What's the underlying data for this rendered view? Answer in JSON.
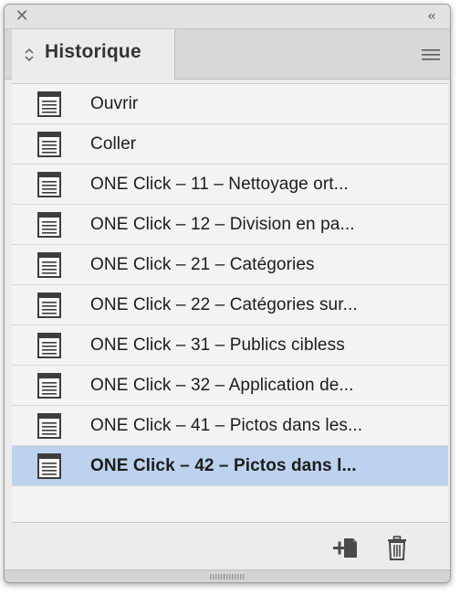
{
  "titlebar": {
    "close_icon": "close-icon",
    "collapse_icon": "double-chevron-left-icon"
  },
  "tab": {
    "label": "Historique",
    "icon": "up-down-chevron-icon"
  },
  "panel_menu_icon": "hamburger-menu-icon",
  "history": {
    "items": [
      {
        "label": "Ouvrir",
        "selected": false
      },
      {
        "label": "Coller",
        "selected": false
      },
      {
        "label": "ONE Click – 11 – Nettoyage ort...",
        "selected": false
      },
      {
        "label": "ONE Click – 12 – Division en pa...",
        "selected": false
      },
      {
        "label": "ONE Click – 21 – Catégories",
        "selected": false
      },
      {
        "label": "ONE Click – 22 – Catégories sur...",
        "selected": false
      },
      {
        "label": "ONE Click – 31 – Publics cibless",
        "selected": false
      },
      {
        "label": "ONE Click – 32 – Application de...",
        "selected": false
      },
      {
        "label": "ONE Click – 41 – Pictos dans les...",
        "selected": false
      },
      {
        "label": "ONE Click – 42 – Pictos dans l...",
        "selected": true
      }
    ],
    "item_icon": "document-icon"
  },
  "footer": {
    "new_document_icon": "new-document-from-state-icon",
    "trash_icon": "trash-icon"
  },
  "colors": {
    "selected_row": "#bcd2ee",
    "panel_bg": "#ececec",
    "list_bg": "#f3f3f3"
  }
}
